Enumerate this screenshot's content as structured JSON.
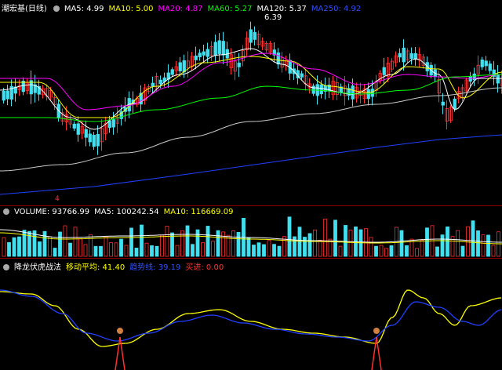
{
  "price_panel": {
    "title": "潮宏基(日线)",
    "ma": [
      {
        "label": "MA5: 4.99",
        "color": "#ffffff"
      },
      {
        "label": "MA10: 5.00",
        "color": "#ffff00"
      },
      {
        "label": "MA20: 4.87",
        "color": "#ff00ff"
      },
      {
        "label": "MA60: 5.27",
        "color": "#00ff00"
      },
      {
        "label": "MA120: 5.37",
        "color": "#d0d0d0"
      },
      {
        "label": "MA250: 4.92",
        "color": "#3050ff"
      }
    ],
    "high_marker": "6.39",
    "low_marker": "4"
  },
  "volume_panel": {
    "items": [
      {
        "label": "VOLUME: 93766.99",
        "color": "#ffffff"
      },
      {
        "label": "MA5: 100242.54",
        "color": "#ffffff"
      },
      {
        "label": "MA10: 116669.09",
        "color": "#ffff00"
      }
    ]
  },
  "indicator_panel": {
    "items": [
      {
        "label": "降龙伏虎战法",
        "color": "#ffffff"
      },
      {
        "label": "移动平均: 41.40",
        "color": "#ffff00"
      },
      {
        "label": "趋势线: 39.19",
        "color": "#3050ff"
      },
      {
        "label": "买进: 0.00",
        "color": "#ff3030"
      }
    ]
  },
  "colors": {
    "up": "#ff3030",
    "down": "#40e0f0",
    "ma5": "#ffffff",
    "ma10": "#ffff00",
    "ma20": "#ff00ff",
    "ma60": "#00ff00",
    "ma120": "#c8c8c8",
    "ma250": "#2040ff"
  }
}
